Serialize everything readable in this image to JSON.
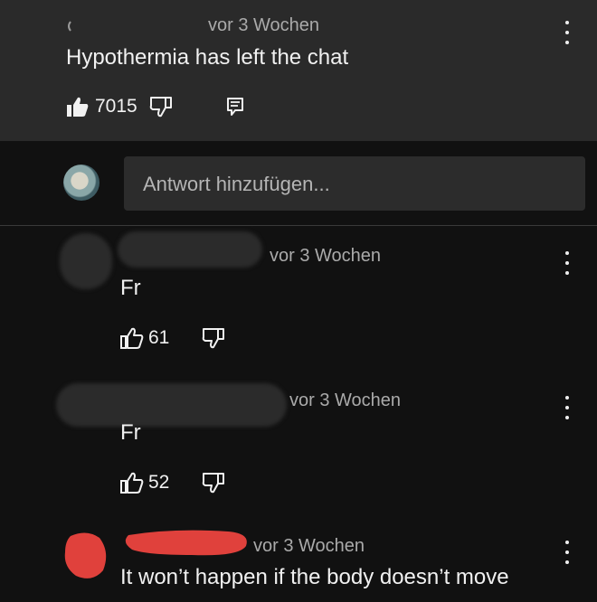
{
  "top_comment": {
    "timestamp": "vor 3 Wochen",
    "text": "Hypothermia has left the chat",
    "like_count": "7015"
  },
  "reply_box": {
    "placeholder": "Antwort hinzufügen..."
  },
  "replies": [
    {
      "timestamp": "vor 3 Wochen",
      "text": "Fr",
      "like_count": "61"
    },
    {
      "timestamp": "vor 3 Wochen",
      "text": "Fr",
      "like_count": "52"
    },
    {
      "timestamp": "vor 3 Wochen",
      "text": "It won’t happen if the body doesn’t move"
    }
  ],
  "colors": {
    "background": "#111111",
    "top_comment_bg": "#2a2a2a",
    "input_bg": "#2c2c2c",
    "redaction_red": "#e0413c"
  }
}
